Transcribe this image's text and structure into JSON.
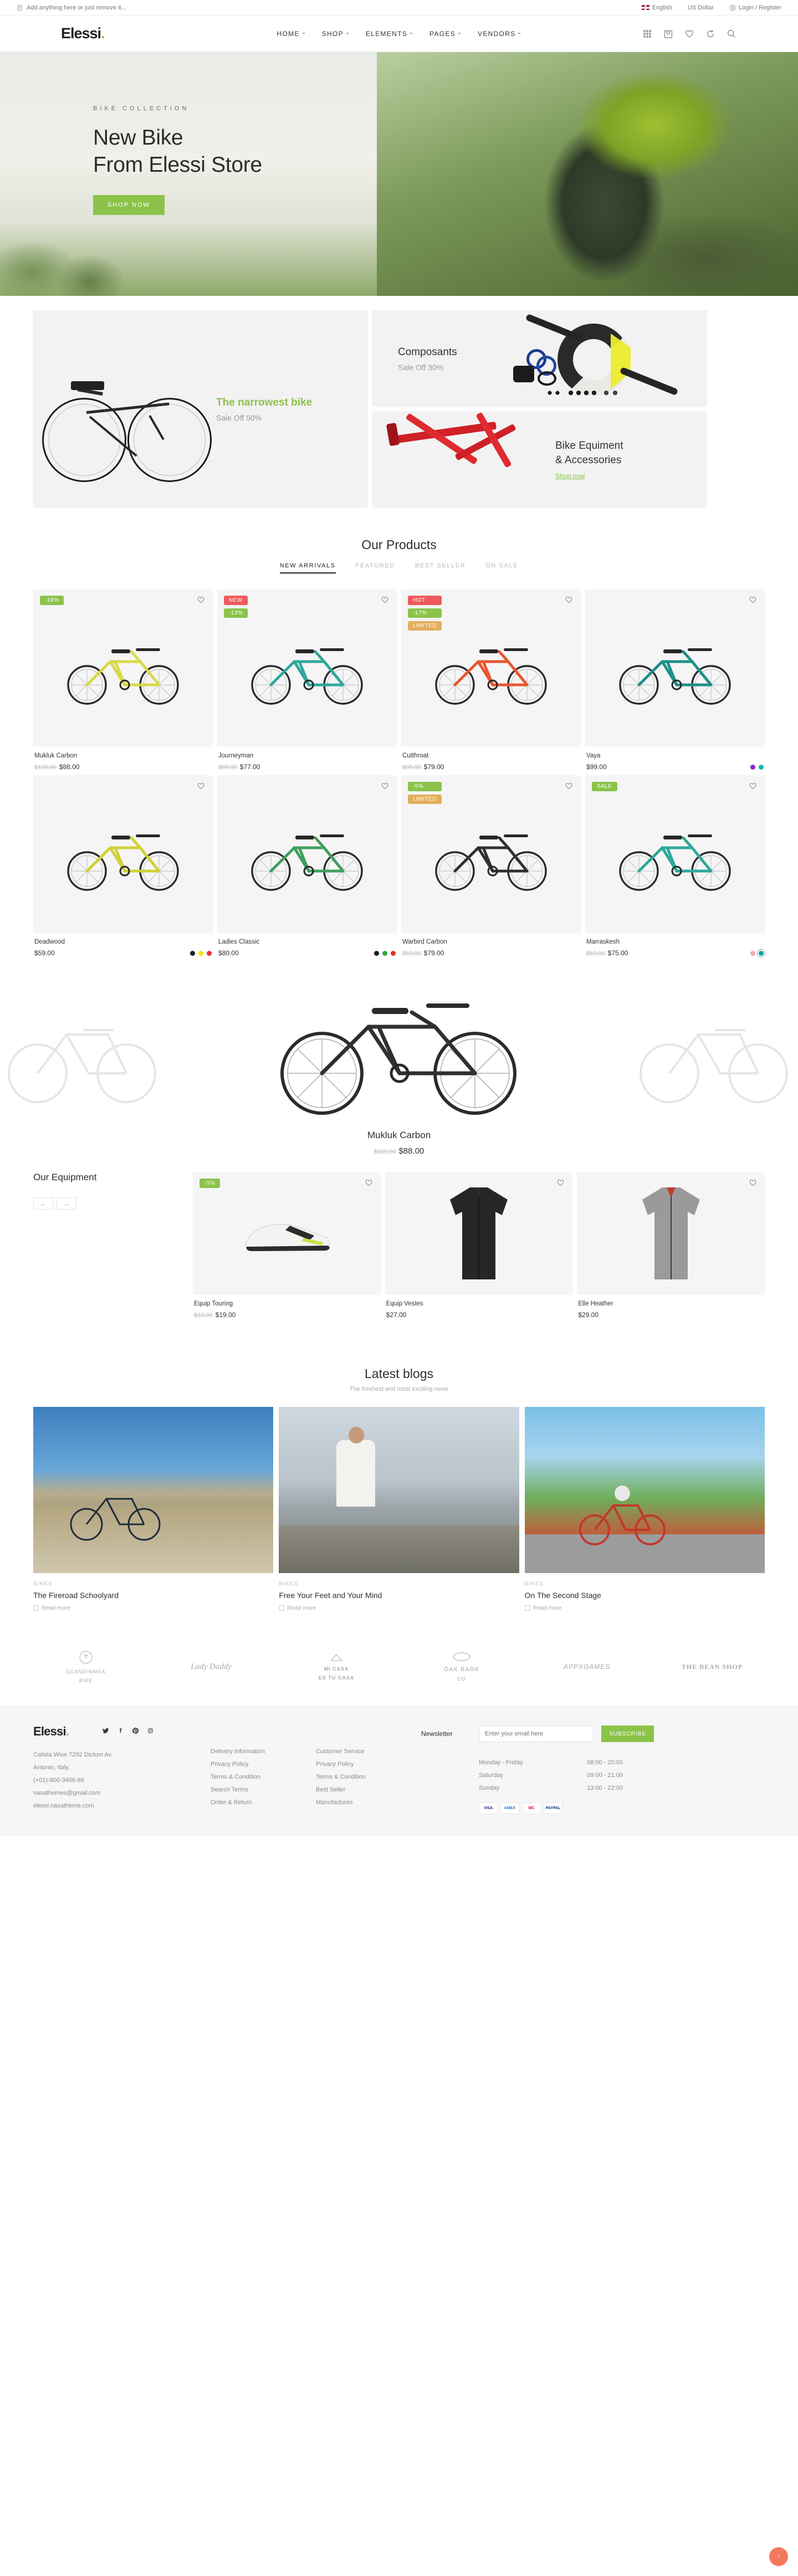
{
  "topbar": {
    "note": "Add anything here or just remove it...",
    "language": "English",
    "currency": "US Dollar",
    "account": "Login / Register"
  },
  "header": {
    "logo": "Elessi",
    "logo_dot": ".",
    "nav": [
      {
        "label": "HOME"
      },
      {
        "label": "SHOP"
      },
      {
        "label": "ELEMENTS"
      },
      {
        "label": "PAGES"
      },
      {
        "label": "VENDORS"
      }
    ],
    "icons": [
      "grid-icon",
      "bag-icon",
      "heart-icon",
      "compare-icon",
      "search-icon"
    ]
  },
  "hero": {
    "eyebrow": "BIKE COLLECTION",
    "title_line1": "New Bike",
    "title_line2": "From Elessi Store",
    "cta": "SHOP NOW"
  },
  "promos": [
    {
      "title": "The narrowest bike",
      "subtitle": "Sale Off 50%",
      "style": "green",
      "link": ""
    },
    {
      "title": "Composants",
      "subtitle": "Sale Off 30%",
      "style": "dark",
      "link": ""
    },
    {
      "title": "Bike Equiment\n& Accessories",
      "subtitle": "",
      "style": "dark",
      "link": "Shop now"
    }
  ],
  "products_section": {
    "title": "Our Products",
    "tabs": [
      {
        "label": "NEW ARRIVALS",
        "active": true
      },
      {
        "label": "FEATURED",
        "active": false
      },
      {
        "label": "BEST SELLER",
        "active": false
      },
      {
        "label": "ON SALE",
        "active": false
      }
    ],
    "items": [
      {
        "name": "Mukluk Carbon",
        "old_price": "$109.00",
        "price": "$88.00",
        "badges": [
          {
            "text": "-19%",
            "color": "green"
          }
        ],
        "swatches": []
      },
      {
        "name": "Journeyman",
        "old_price": "$89.00",
        "price": "$77.00",
        "badges": [
          {
            "text": "NEW",
            "color": "red"
          },
          {
            "text": "-13%",
            "color": "green"
          }
        ],
        "swatches": []
      },
      {
        "name": "Cutthroat",
        "old_price": "$95.00",
        "price": "$79.00",
        "badges": [
          {
            "text": "HOT",
            "color": "red"
          },
          {
            "text": "-17%",
            "color": "green"
          },
          {
            "text": "LIMITED",
            "color": "orange"
          }
        ],
        "swatches": []
      },
      {
        "name": "Vaya",
        "old_price": "",
        "price": "$99.00",
        "badges": [],
        "swatches": [
          "#8e24c9",
          "#18b4ae"
        ]
      },
      {
        "name": "Deadwood",
        "old_price": "",
        "price": "$59.00",
        "badges": [],
        "swatches": [
          "#1d1d1d",
          "#f2e300",
          "#e82d2d"
        ]
      },
      {
        "name": "Ladies Classic",
        "old_price": "",
        "price": "$80.00",
        "badges": [],
        "swatches": [
          "#1d1d1d",
          "#2eab2e",
          "#e82d2d"
        ]
      },
      {
        "name": "Warbird Carbon",
        "old_price": "$83.00",
        "price": "$79.00",
        "badges": [
          {
            "text": "-5%",
            "color": "green"
          },
          {
            "text": "LIMITED",
            "color": "orange"
          }
        ],
        "swatches": []
      },
      {
        "name": "Marraskesh",
        "old_price": "$83.00",
        "price": "$75.00",
        "badges": [
          {
            "text": "SALE",
            "color": "green"
          }
        ],
        "swatches": [
          "#f9a3b0",
          "#0ea79c"
        ]
      }
    ]
  },
  "featured": {
    "name": "Mukluk Carbon",
    "old_price": "$109.00",
    "price": "$88.00"
  },
  "equipment": {
    "title": "Our Equipment",
    "prev": "←",
    "next": "→",
    "items": [
      {
        "name": "Equip Touring",
        "old_price": "$33.00",
        "price": "$19.00",
        "badges": [
          {
            "text": "-5%",
            "color": "green"
          }
        ]
      },
      {
        "name": "Equip Vestes",
        "old_price": "",
        "price": "$27.00",
        "badges": []
      },
      {
        "name": "Elle Heather",
        "old_price": "",
        "price": "$29.00",
        "badges": []
      }
    ]
  },
  "blogs": {
    "title": "Latest blogs",
    "subtitle": "The freshest and most exciting news",
    "read_more": "Read more",
    "posts": [
      {
        "category": "BIKES",
        "title": "The Fireroad Schoolyard"
      },
      {
        "category": "BIKES",
        "title": "Free Your Feet and Your Mind"
      },
      {
        "category": "BIKES",
        "title": "On The Second Stage"
      }
    ]
  },
  "brands": [
    {
      "name": "SCANDINAVIA",
      "sub": "BIKE"
    },
    {
      "name": "Lady Daddy",
      "sub": ""
    },
    {
      "name": "MI CASA",
      "sub": "ES TU CASA"
    },
    {
      "name": "OAK BARK",
      "sub": "CO"
    },
    {
      "name": "APPXGAMES",
      "sub": ""
    },
    {
      "name": "THE BEAN SHOP",
      "sub": ""
    }
  ],
  "footer": {
    "logo": "Elessi",
    "logo_dot": ".",
    "social": [
      "twitter-icon",
      "facebook-icon",
      "pinterest-icon",
      "instagram-icon"
    ],
    "address": [
      "Calista Wise 7292 Dictum Av.",
      "Antonio, Italy.",
      "(+01)-800-3456-88",
      "nasathemes@gmail.com",
      "elessi.nasatheme.com"
    ],
    "col1": {
      "title": "",
      "links": [
        "Delivery Information",
        "Privacy Policy",
        "Terms & Condition",
        "Search Terms",
        "Order & Return"
      ]
    },
    "col2": {
      "title": "",
      "links": [
        "Customer Service",
        "Privacy Policy",
        "Terms & Condition",
        "Best Seller",
        "Manufactures"
      ]
    },
    "newsletter": {
      "title": "Newsletter",
      "placeholder": "Enter your email here",
      "button": "SUBSCRIBE"
    },
    "hours": [
      {
        "day": "Monday - Friday",
        "time": "08:00 - 20:00"
      },
      {
        "day": "Saturday",
        "time": "09:00 - 21:00"
      },
      {
        "day": "Sunday",
        "time": "13:00 - 22:00"
      }
    ],
    "payments": [
      "VISA",
      "AMEX",
      "MC",
      "PAYPAL"
    ]
  },
  "misc": {
    "back_to_top": "↑"
  },
  "colors": {
    "accent": "#8bc34a",
    "badge_red": "#ee5a5a",
    "badge_orange": "#e2ae5b",
    "text": "#333333",
    "muted": "#999999"
  }
}
